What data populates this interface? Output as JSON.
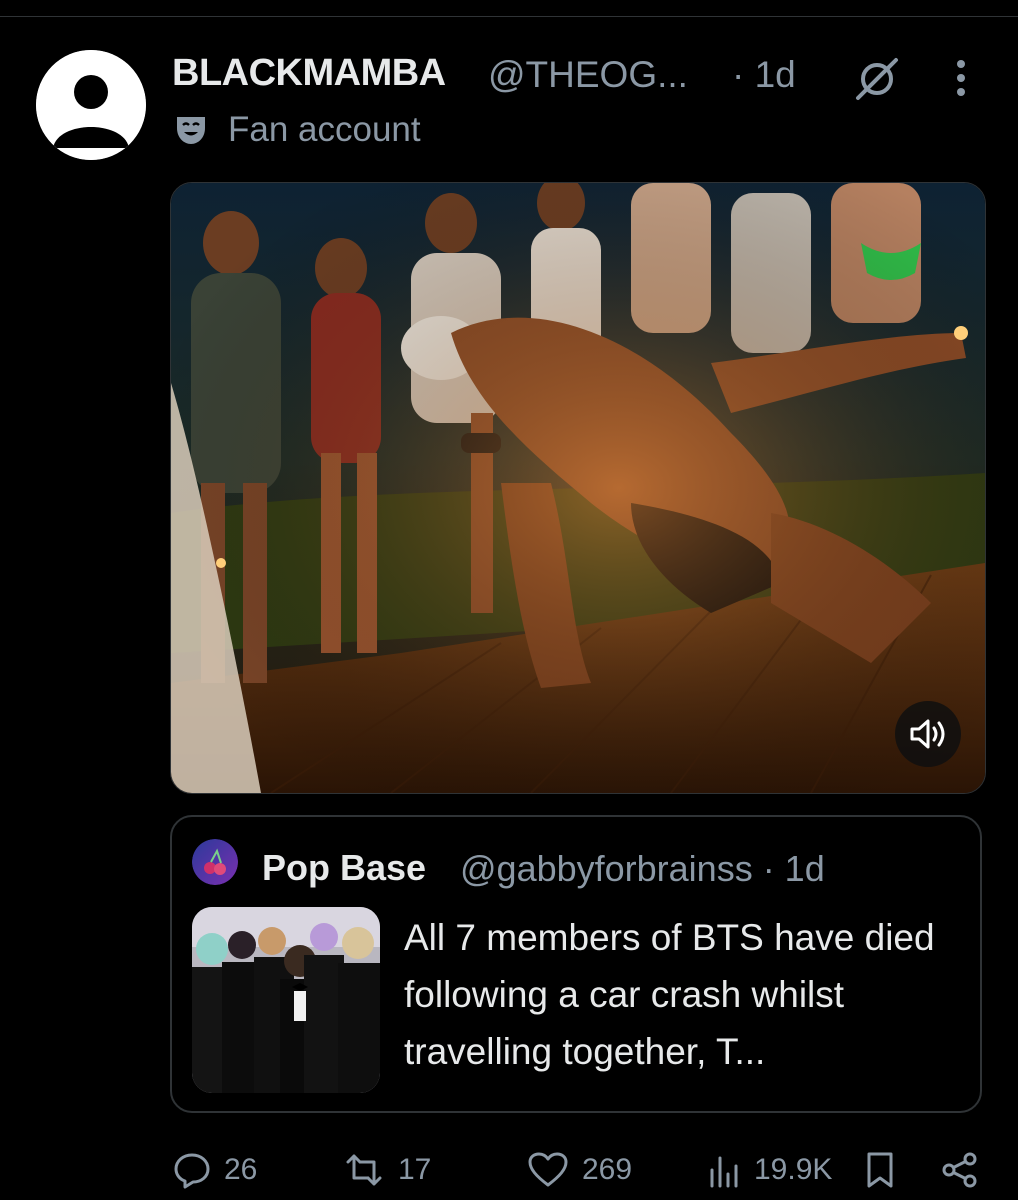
{
  "tweet": {
    "display_name": "BLACKMAMBA",
    "handle": "@THEOG...",
    "time": "· 1d",
    "label": "Fan account",
    "icons": {
      "avatar": "default-avatar-icon",
      "grok": "grok-icon",
      "more": "more-dots-icon",
      "label": "theater-mask-icon",
      "sound": "speaker-icon"
    }
  },
  "quote": {
    "display_name": "Pop Base",
    "handle": "@gabbyforbrainss · 1d",
    "text": "All 7 members of BTS have died following a car crash whilst travelling together, T..."
  },
  "actions": {
    "replies": "26",
    "reposts": "17",
    "likes": "269",
    "views": "19.9K"
  },
  "colors": {
    "background": "#000000",
    "primary_text": "#e7e9ea",
    "secondary_text": "#8b98a5",
    "border": "#2f3336"
  }
}
